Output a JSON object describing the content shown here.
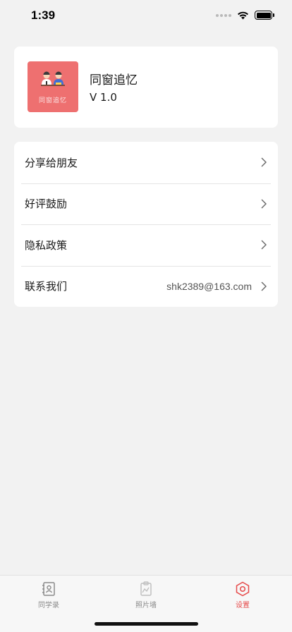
{
  "status_bar": {
    "time": "1:39"
  },
  "app": {
    "name": "同窗追忆",
    "version": "V 1.0",
    "logo_caption": "同窗追忆"
  },
  "menu": {
    "items": [
      {
        "label": "分享给朋友",
        "value": ""
      },
      {
        "label": "好评鼓励",
        "value": ""
      },
      {
        "label": "隐私政策",
        "value": ""
      },
      {
        "label": "联系我们",
        "value": "shk2389@163.com"
      }
    ]
  },
  "tabs": [
    {
      "label": "同学录",
      "icon": "contacts-book-icon",
      "active": false
    },
    {
      "label": "照片墙",
      "icon": "photo-icon",
      "active": false
    },
    {
      "label": "设置",
      "icon": "settings-hexagon-icon",
      "active": true
    }
  ],
  "colors": {
    "accent": "#e64a4a",
    "logo_bg": "#ee7070",
    "background": "#f2f2f2"
  }
}
